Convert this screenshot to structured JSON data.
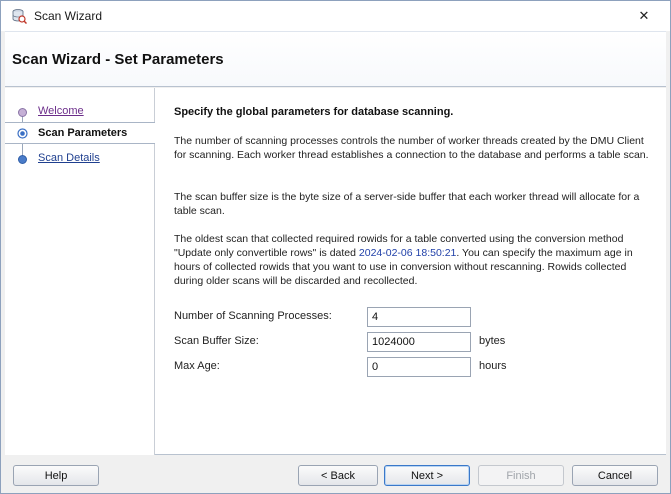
{
  "window": {
    "title": "Scan Wizard",
    "close_glyph": "✕"
  },
  "header": {
    "title": "Scan Wizard - Set Parameters"
  },
  "nav": {
    "items": [
      {
        "label": "Welcome",
        "state": "visited"
      },
      {
        "label": "Scan Parameters",
        "state": "active"
      },
      {
        "label": "Scan Details",
        "state": "link"
      }
    ]
  },
  "content": {
    "heading": "Specify the global parameters for database scanning.",
    "para1": "The number of scanning processes controls the number of worker threads created by the DMU Client for scanning. Each worker thread establishes a connection to the database and performs a table scan.",
    "para2": "The scan buffer size is the byte size of a server-side buffer that each worker thread will allocate for a table scan.",
    "para3_before": "The oldest scan that collected required rowids for a table converted using the conversion method \"Update only convertible rows\" is dated ",
    "para3_date": "2024-02-06 18:50:21",
    "para3_after": ". You can specify the maximum age in hours of collected rowids that you want to use in conversion without rescanning. Rowids collected during older scans will be discarded and recollected."
  },
  "form": {
    "processes_label": "Number of Scanning Processes:",
    "processes_value": "4",
    "buffer_label": "Scan Buffer Size:",
    "buffer_value": "1024000",
    "buffer_unit": "bytes",
    "max_age_label": "Max Age:",
    "max_age_value": "0",
    "max_age_unit": "hours"
  },
  "buttons": {
    "help": "Help",
    "back": "< Back",
    "next": "Next >",
    "finish": "Finish",
    "cancel": "Cancel"
  },
  "colors": {
    "link": "#1f3f8f",
    "visited_link": "#6b2d8a",
    "date_link": "#1f3fa8",
    "default_button_border": "#3a78c9"
  },
  "icons": {
    "app": "scan-wizard-icon",
    "close": "close-icon",
    "nav_step": "step-dot-icon"
  }
}
